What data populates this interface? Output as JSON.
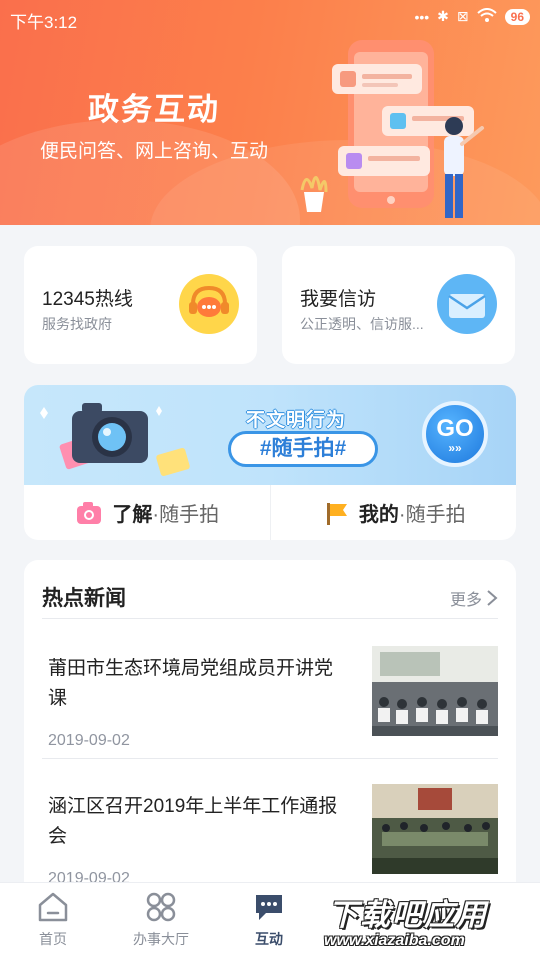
{
  "status_bar": {
    "time": "下午3:12",
    "battery": "96"
  },
  "hero": {
    "title": "政务互动",
    "subtitle": "便民问答、网上咨询、互动"
  },
  "services": [
    {
      "title": "12345热线",
      "subtitle": "服务找政府"
    },
    {
      "title": "我要信访",
      "subtitle": "公正透明、信访服..."
    }
  ],
  "snapshot": {
    "tagline": "不文明行为",
    "hashtag": "#随手拍#",
    "go_label": "GO",
    "links": [
      {
        "bold": "了解",
        "rest": "·随手拍"
      },
      {
        "bold": "我的",
        "rest": "·随手拍"
      }
    ]
  },
  "news": {
    "heading": "热点新闻",
    "more": "更多",
    "items": [
      {
        "title": "莆田市生态环境局党组成员开讲党课",
        "date": "2019-09-02"
      },
      {
        "title": "涵江区召开2019年上半年工作通报会",
        "date": "2019-09-02"
      }
    ]
  },
  "tabs": [
    {
      "label": "首页",
      "icon": "home-icon",
      "active": false
    },
    {
      "label": "办事大厅",
      "icon": "grid-icon",
      "active": false
    },
    {
      "label": "互动",
      "icon": "chat-icon",
      "active": true
    }
  ],
  "watermark": {
    "title": "下载吧应用",
    "url": "www.xiazaiba.com"
  },
  "colors": {
    "hero_start": "#fa6f4c",
    "hero_end": "#fd9a5c",
    "active_tab": "#3b4d6b",
    "accent_blue": "#2d7fd8"
  }
}
